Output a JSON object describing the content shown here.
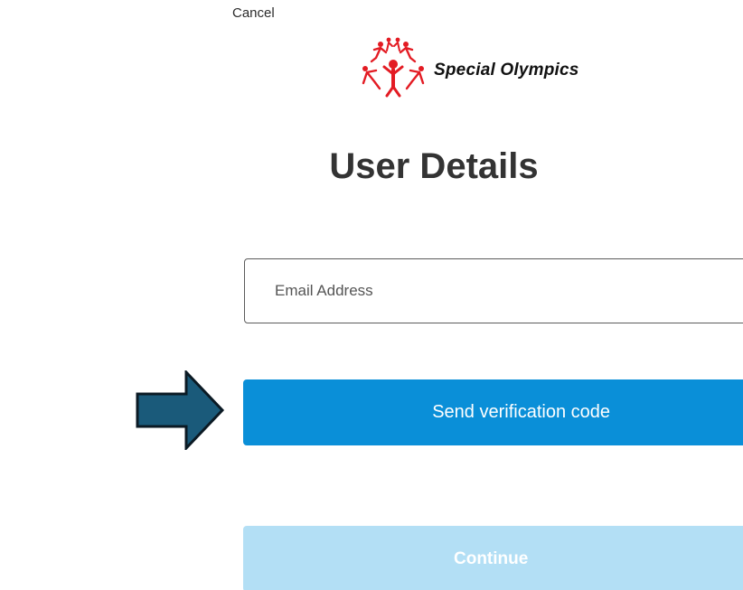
{
  "header": {
    "cancel_label": "Cancel",
    "logo": {
      "brand_name": "Special Olympics",
      "icon": "special-olympics-logo-icon",
      "brand_color": "#e31b23"
    }
  },
  "main": {
    "title": "User Details",
    "email": {
      "placeholder": "Email Address",
      "value": ""
    },
    "send_code_label": "Send verification code",
    "continue_label": "Continue",
    "continue_disabled": true
  },
  "annotation": {
    "icon": "right-arrow-icon",
    "fill_color": "#1a5a7a",
    "stroke_color": "#0b1a24"
  },
  "colors": {
    "primary_button": "#0a8fd8",
    "disabled_button": "#b3dff5",
    "title_text": "#333333"
  }
}
